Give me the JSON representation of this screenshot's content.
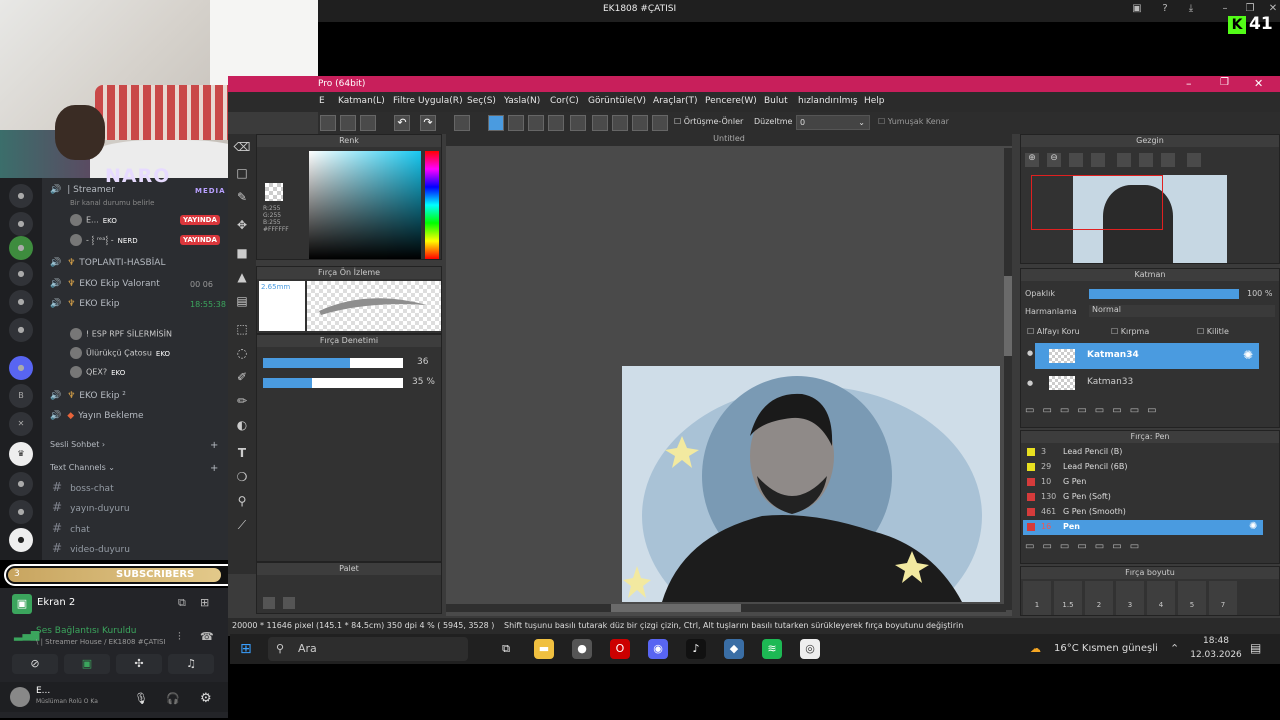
{
  "stream": {
    "title": "EK1808 #ÇATISI",
    "kick_count": "41",
    "overlay_brand": "NARO",
    "overlay_sub": "MEDIA"
  },
  "discord": {
    "streamer_channel": "| Streamer",
    "streamer_status": "Bir kanal durumu belirle",
    "live_label": "YAYINDA",
    "users_top": [
      {
        "name": "E...",
        "tag": "EKO"
      },
      {
        "name": "- ⸾ ʳᵉᵃ⸾ -",
        "tag": "NERD"
      }
    ],
    "channels": [
      {
        "label": "TOPLANTI-HASBİAL"
      },
      {
        "label": "EKO Ekip Valorant",
        "badge_a": "00",
        "badge_b": "06"
      },
      {
        "label": "EKO Ekip",
        "time": "18:55:38"
      }
    ],
    "ekip_users": [
      {
        "name": "! ESP RPF SİLERMİSİN"
      },
      {
        "name": "Ülürükçü Çatosu",
        "tag": "EKO"
      },
      {
        "name": "QEX?",
        "tag": "EKO"
      }
    ],
    "channels2": [
      {
        "label": "EKO Ekip ²"
      },
      {
        "label": "Yayın Bekleme"
      }
    ],
    "section_voice": "Sesli Sohbet",
    "section_text": "Text Channels",
    "text_channels": [
      "boss-chat",
      "yayın-duyuru",
      "chat",
      "video-duyuru"
    ],
    "subs": {
      "label": "SUBSCRIBERS",
      "current": "3",
      "goal": "4",
      "progress": 0.75
    },
    "screen_share": "Ekran 2",
    "voice_connected": "Ses Bağlantısı Kuruldu",
    "voice_channel": "\\ | Streamer House / EK1808 #ÇATISI",
    "me_name": "E...",
    "me_status": "Müslüman Rolü O Ka"
  },
  "csp": {
    "title": "Pro (64bit)",
    "menus": [
      "Katman(L)",
      "Filtre Uygula(R)",
      "Seç(S)",
      "Yasla(N)",
      "Cor(C)",
      "Görüntüle(V)",
      "Araçlar(T)",
      "Pencere(W)",
      "Bulut",
      "hızlandırılmış",
      "Help"
    ],
    "menu_first": "E",
    "toolbar_overlap": "Örtüşme-Önler",
    "toolbar_correction": "Düzeltme",
    "toolbar_correction_value": "0",
    "toolbar_soft": "Yumuşak Kenar",
    "canvas_tab": "Untitled",
    "color_panel": "Renk",
    "color_values": "R:255\nG:255\nB:255\n#FFFFFF",
    "brush_preview_panel": "Fırça Ön İzleme",
    "brush_preview_size": "2.65mm",
    "brush_control_panel": "Fırça Denetimi",
    "brush_size": "36",
    "brush_opacity": "35 %",
    "brush_opacity_level": 0.35,
    "palette_panel": "Palet",
    "navigator_panel": "Gezgin",
    "layer_panel": "Katman",
    "opacity_label": "Opaklık",
    "opacity_value": "100 %",
    "blend_label": "Harmanlama",
    "blend_value": "Normal",
    "alpha_lock": "Alfayı Koru",
    "clip": "Kırpma",
    "lock": "Kilitle",
    "layers": [
      "Katman34",
      "Katman33"
    ],
    "brush_panel": "Fırça: Pen",
    "brushes": [
      {
        "num": "3",
        "name": "Lead Pencil (B)",
        "color": "#e8e020"
      },
      {
        "num": "29",
        "name": "Lead Pencil (6B)",
        "color": "#e8e020"
      },
      {
        "num": "10",
        "name": "G Pen",
        "color": "#d63b3b"
      },
      {
        "num": "130",
        "name": "G Pen (Soft)",
        "color": "#d63b3b"
      },
      {
        "num": "461",
        "name": "G Pen (Smooth)",
        "color": "#d63b3b"
      },
      {
        "num": "16",
        "name": "Pen",
        "color": "#d63b3b"
      }
    ],
    "brush_size_panel": "Fırça boyutu",
    "brush_sizes": [
      "1",
      "1.5",
      "2",
      "3",
      "4",
      "5",
      "7"
    ],
    "status_left": "20000 * 11646 pixel  (145.1 * 84.5cm)  350 dpi  4 %  ( 5945, 3528 )",
    "status_msg": "Shift tuşunu basılı tutarak düz bir çizgi çizin, Ctrl, Alt tuşlarını basılı tutarken sürükleyerek fırça boyutunu değiştirin"
  },
  "taskbar": {
    "search": "Ara",
    "weather": "16°C  Kısmen güneşli",
    "time": "18:48",
    "date": "12.03.2026"
  }
}
